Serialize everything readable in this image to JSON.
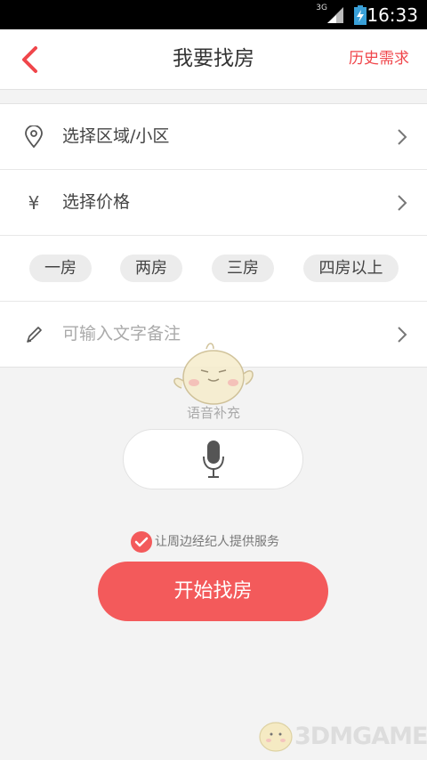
{
  "status_bar": {
    "network": "3G",
    "time": "16:33"
  },
  "header": {
    "title": "我要找房",
    "history_label": "历史需求"
  },
  "form": {
    "area_label": "选择区域/小区",
    "price_icon": "¥",
    "price_label": "选择价格",
    "room_options": [
      "一房",
      "两房",
      "三房",
      "四房以上"
    ],
    "note_placeholder": "可输入文字备注"
  },
  "voice": {
    "label": "语音补充"
  },
  "agreement": {
    "text": "让周边经纪人提供服务",
    "checked": true
  },
  "start_button": {
    "label": "开始找房"
  },
  "watermark": {
    "text": "3DMGAME"
  },
  "colors": {
    "accent": "#f35a5b",
    "accent_text": "#f0464b"
  }
}
